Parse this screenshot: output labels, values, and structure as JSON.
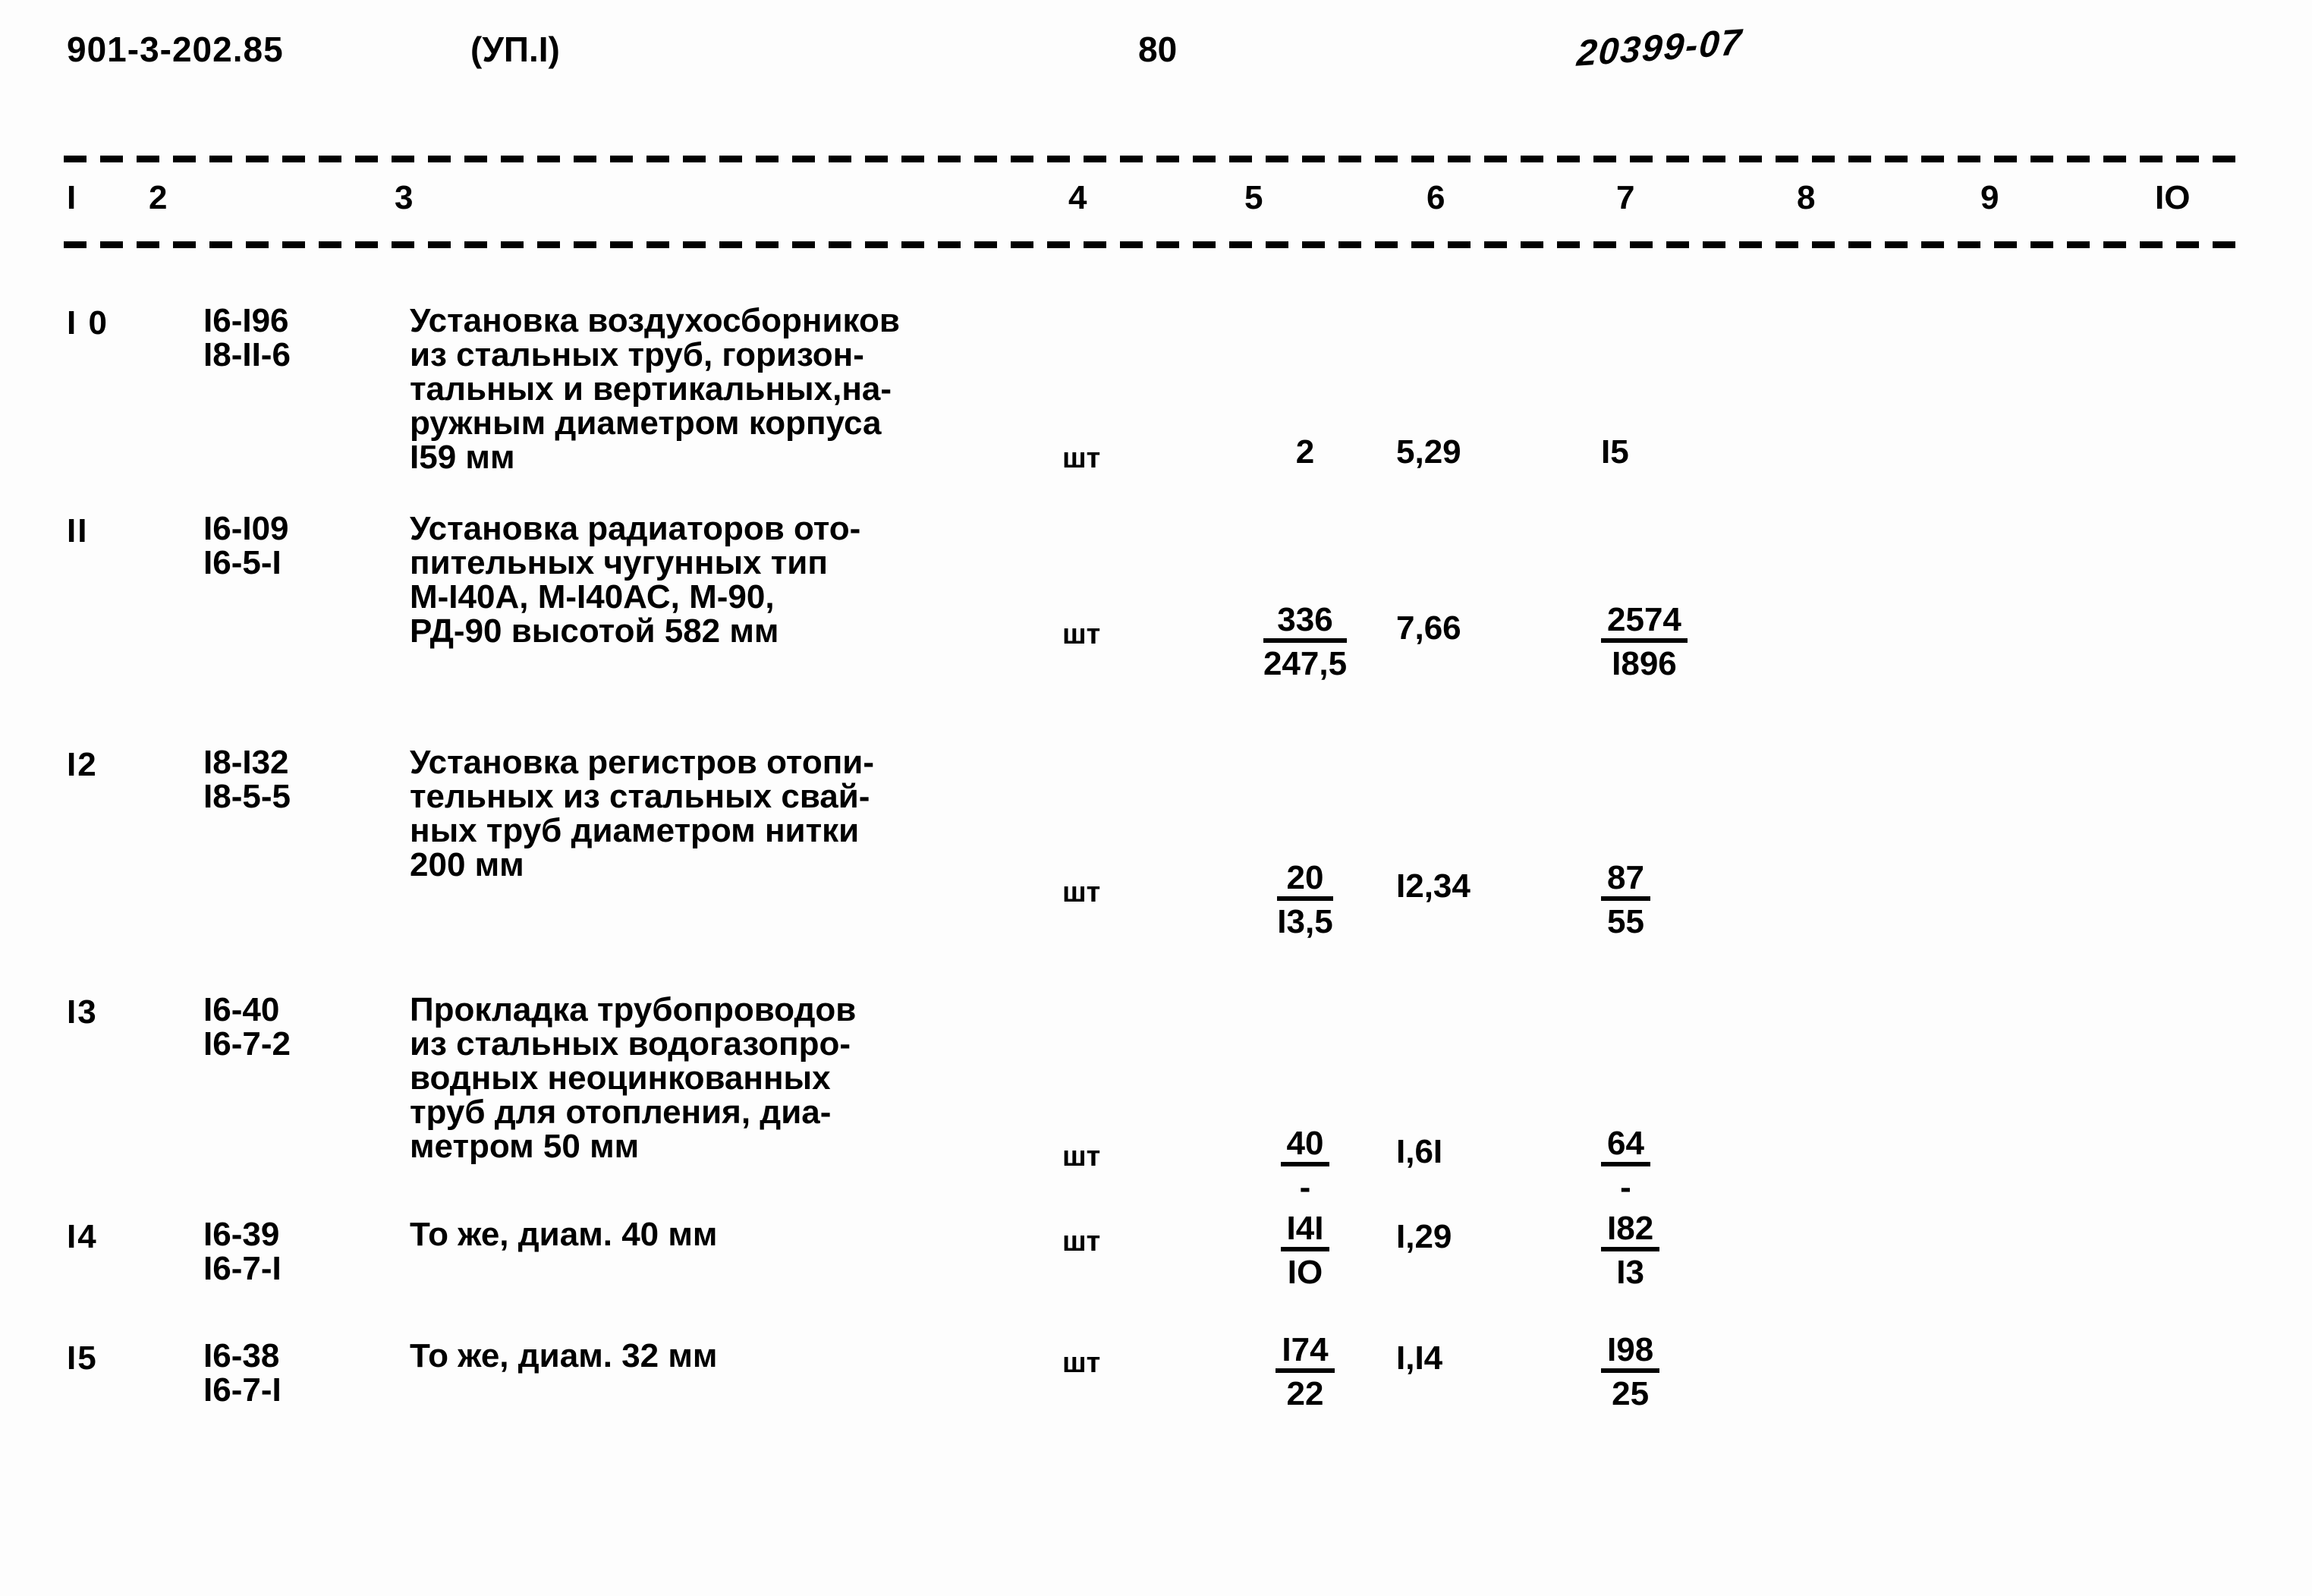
{
  "header": {
    "doc_code": "901-3-202.85",
    "album": "(УП.I)",
    "page_number": "80",
    "stamp": "20399-07"
  },
  "table": {
    "column_numbers": [
      "I",
      "2",
      "3",
      "4",
      "5",
      "6",
      "7",
      "8",
      "9",
      "IO"
    ],
    "rows": [
      {
        "no": "I 0",
        "code_line1": "I6-I96",
        "code_line2": "I8-II-6",
        "description": "Установка воздухосборников\nиз стальных труб, горизон-\nтальных и вертикальных,на-\nружным диаметром корпуса\nI59 мм",
        "unit": "шт",
        "col5_num": "2",
        "col5_den": "",
        "col6": "5,29",
        "col7_num": "I5",
        "col7_den": ""
      },
      {
        "no": "II",
        "code_line1": "I6-I09",
        "code_line2": "I6-5-I",
        "description": "Установка радиаторов ото-\nпительных чугунных тип\nМ-I40А, М-I40АС, М-90,\nРД-90 высотой 582 мм",
        "unit": "шт",
        "col5_num": "336",
        "col5_den": "247,5",
        "col6": "7,66",
        "col7_num": "2574",
        "col7_den": "I896"
      },
      {
        "no": "I2",
        "code_line1": "I8-I32",
        "code_line2": "I8-5-5",
        "description": "Установка регистров отопи-\nтельных из стальных свай-\nных труб диаметром нитки\n200 мм",
        "unit": "шт",
        "col5_num": "20",
        "col5_den": "I3,5",
        "col6": "I2,34",
        "col7_num": "87",
        "col7_den": "55"
      },
      {
        "no": "I3",
        "code_line1": "I6-40",
        "code_line2": "I6-7-2",
        "description": "Прокладка трубопроводов\nиз стальных водогазопро-\nводных неоцинкованных\nтруб для отопления, диа-\nметром 50 мм",
        "unit": "шт",
        "col5_num": "40",
        "col5_den": "-",
        "col6": "I,6I",
        "col7_num": "64",
        "col7_den": "-"
      },
      {
        "no": "I4",
        "code_line1": "I6-39",
        "code_line2": "I6-7-I",
        "description": "То же, диам. 40 мм",
        "unit": "шт",
        "col5_num": "I4I",
        "col5_den": "IO",
        "col6": "I,29",
        "col7_num": "I82",
        "col7_den": "I3"
      },
      {
        "no": "I5",
        "code_line1": "I6-38",
        "code_line2": "I6-7-I",
        "description": "То же, диам. 32 мм",
        "unit": "шт",
        "col5_num": "I74",
        "col5_den": "22",
        "col6": "I,I4",
        "col7_num": "I98",
        "col7_den": "25"
      }
    ]
  }
}
